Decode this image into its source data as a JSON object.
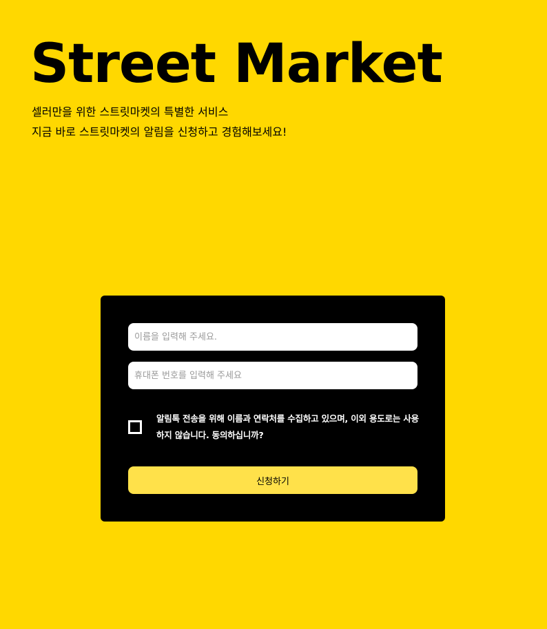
{
  "hero": {
    "title": "Street Market",
    "subtitle_line1": "셀러만을 위한 스트릿마켓의 특별한 서비스",
    "subtitle_line2": "지금 바로 스트릿마켓의 알림을 신청하고 경험해보세요!"
  },
  "form": {
    "name_placeholder": "이름을 입력해 주세요.",
    "name_value": "",
    "phone_placeholder": "휴대폰 번호를 입력해 주세요",
    "phone_value": "",
    "consent_checked": false,
    "consent_text": "알림톡 전송을 위해 이름과 연락처를 수집하고 있으며, 이외 용도로는 사용하지 않습니다. 동의하십니까?",
    "submit_label": "신청하기"
  },
  "colors": {
    "background": "#FFD800",
    "card": "#000000",
    "button": "#FFE14A"
  }
}
